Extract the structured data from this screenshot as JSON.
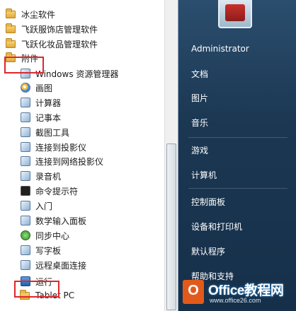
{
  "programs": [
    {
      "label": "冰尘软件",
      "icon": "folder-icon",
      "indent": 0
    },
    {
      "label": "飞跃服饰店管理软件",
      "icon": "folder-icon",
      "indent": 0
    },
    {
      "label": "飞跃化妆品管理软件",
      "icon": "folder-icon",
      "indent": 0
    },
    {
      "label": "附件",
      "icon": "folder-icon",
      "indent": 0,
      "highlighted": true
    },
    {
      "label": "Windows 资源管理器",
      "icon": "explorer-icon",
      "indent": 1
    },
    {
      "label": "画图",
      "icon": "paint-icon",
      "indent": 1
    },
    {
      "label": "计算器",
      "icon": "calculator-icon",
      "indent": 1
    },
    {
      "label": "记事本",
      "icon": "notepad-icon",
      "indent": 1
    },
    {
      "label": "截图工具",
      "icon": "snipping-tool-icon",
      "indent": 1
    },
    {
      "label": "连接到投影仪",
      "icon": "projector-icon",
      "indent": 1
    },
    {
      "label": "连接到网络投影仪",
      "icon": "network-projector-icon",
      "indent": 1
    },
    {
      "label": "录音机",
      "icon": "microphone-icon",
      "indent": 1
    },
    {
      "label": "命令提示符",
      "icon": "command-prompt-icon",
      "indent": 1
    },
    {
      "label": "入门",
      "icon": "getting-started-icon",
      "indent": 1
    },
    {
      "label": "数学输入面板",
      "icon": "math-input-icon",
      "indent": 1
    },
    {
      "label": "同步中心",
      "icon": "sync-center-icon",
      "indent": 1
    },
    {
      "label": "写字板",
      "icon": "wordpad-icon",
      "indent": 1
    },
    {
      "label": "远程桌面连接",
      "icon": "remote-desktop-icon",
      "indent": 1
    },
    {
      "label": "运行",
      "icon": "run-icon",
      "indent": 1,
      "highlighted": true
    },
    {
      "label": "Tablet PC",
      "icon": "folder-icon",
      "indent": 1
    }
  ],
  "right_items": [
    {
      "label": "Administrator"
    },
    {
      "label": "文档"
    },
    {
      "label": "图片"
    },
    {
      "label": "音乐"
    },
    {
      "label": "游戏"
    },
    {
      "label": "计算机"
    },
    {
      "label": "控制面板"
    },
    {
      "label": "设备和打印机"
    },
    {
      "label": "默认程序"
    },
    {
      "label": "帮助和支持"
    }
  ],
  "watermark": {
    "logo_letter": "O",
    "title": "Office教程网",
    "subtitle": "www.office26.com"
  },
  "colors": {
    "highlight_box": "#e0262b",
    "right_pane": "#1b3752",
    "left_pane": "#ffffff"
  }
}
